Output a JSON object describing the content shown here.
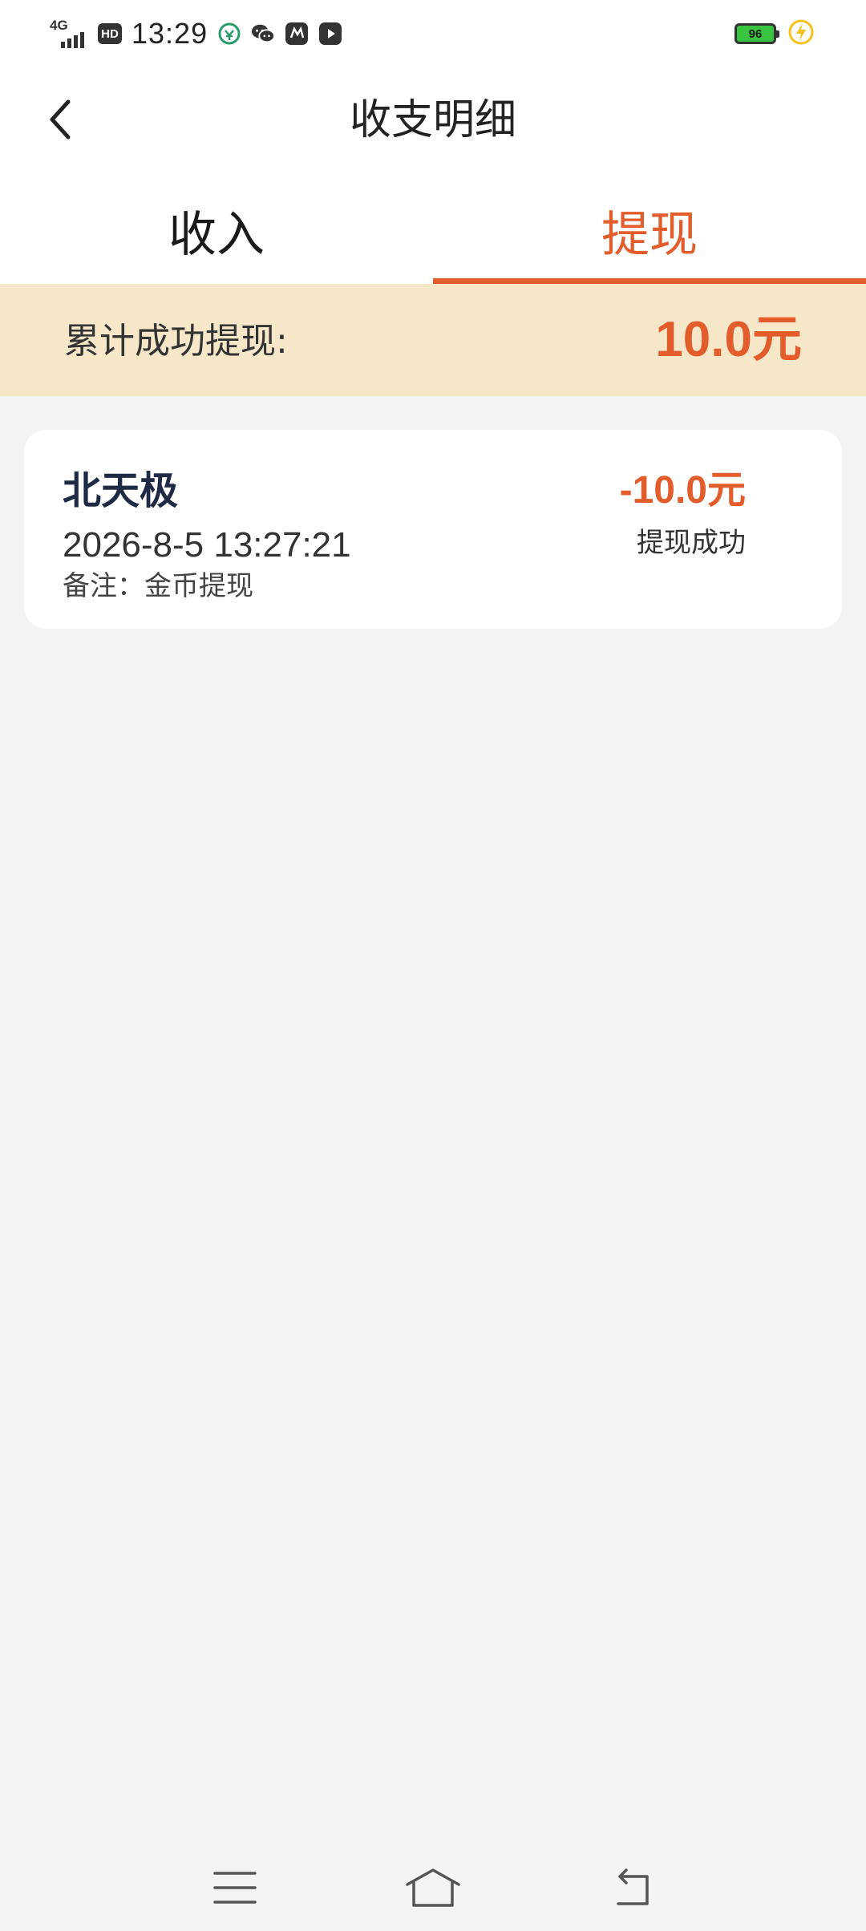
{
  "status_bar": {
    "network": "4G",
    "hd_badge": "HD",
    "time": "13:29",
    "battery": "96",
    "icons": [
      "bank-app-icon",
      "wechat-icon",
      "app-icon",
      "video-app-icon",
      "charging-icon"
    ]
  },
  "header": {
    "title": "收支明细",
    "back_icon": "chevron-left-icon"
  },
  "tabs": [
    {
      "label": "收入",
      "active": false
    },
    {
      "label": "提现",
      "active": true
    }
  ],
  "summary": {
    "label": "累计成功提现:",
    "value": "10.0元"
  },
  "records": [
    {
      "name": "北天极",
      "time": "2026-8-5 13:27:21",
      "note": "备注：金币提现",
      "amount": "-10.0元",
      "status": "提现成功"
    }
  ],
  "nav": {
    "icons": [
      "menu-icon",
      "home-icon",
      "back-icon"
    ]
  },
  "colors": {
    "accent": "#e25d2b",
    "summary_bg": "#f5e7c8",
    "page_bg": "#f4f4f4"
  }
}
